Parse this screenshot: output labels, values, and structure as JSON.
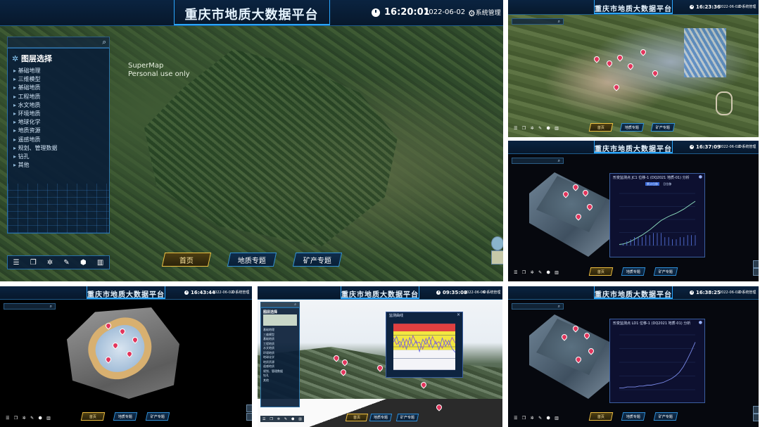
{
  "app_title": "重庆市地质大数据平台",
  "system_menu": "系统管理",
  "nav_buttons": {
    "home": "首页",
    "geology": "地质专题",
    "mining": "矿产专题"
  },
  "main_panel": {
    "time": "16:20:01",
    "date": "2022-06-02",
    "watermark_line1": "SuperMap",
    "watermark_line2": "Personal use only",
    "layer_panel_title": "图层选择",
    "layer_items": [
      "基础地理",
      "三维模型",
      "基础地质",
      "工程地质",
      "水文地质",
      "环境地质",
      "地球化学",
      "地质资源",
      "遥感地质",
      "规划、管理数据",
      "钻孔",
      "其他"
    ]
  },
  "panel_tr": {
    "time": "16:23:36",
    "date": "2022-06-02"
  },
  "panel_mr": {
    "time": "16:37:09",
    "date": "2022-06-02",
    "chart_title": "形变监测点 JC1 位移-1 (DQ2021 地质-01) 分析",
    "legend": [
      "累计位移",
      "日位移"
    ],
    "chart_data": {
      "type": "line",
      "x": [
        0,
        1,
        2,
        3,
        4,
        5,
        6,
        7,
        8,
        9,
        10,
        11,
        12,
        13,
        14,
        15,
        16,
        17,
        18,
        19,
        20
      ],
      "series": [
        {
          "values": [
            2,
            3,
            5,
            8,
            12,
            16,
            20,
            25,
            30,
            36,
            42,
            48,
            52,
            56,
            59,
            62,
            66,
            70,
            75,
            80,
            85
          ]
        }
      ],
      "ylim": [
        0,
        100
      ]
    }
  },
  "panel_bl": {
    "time": "16:43:44",
    "date": "2022-06-02"
  },
  "panel_bm": {
    "time": "09:35:08",
    "date": "2022-06-06",
    "tree_title": "图层选择",
    "tree_items": [
      "基础地理",
      "三维模型",
      "基础地质",
      "工程地质",
      "水文地质",
      "环境地质",
      "地球化学",
      "地质资源",
      "遥感地质",
      "规划、管理数据",
      "钻孔",
      "其他"
    ],
    "chart_title": "监测曲线",
    "chart_data": {
      "type": "line",
      "x": [
        0,
        1,
        2,
        3,
        4,
        5,
        6,
        7,
        8,
        9,
        10,
        11,
        12,
        13,
        14,
        15,
        16,
        17,
        18,
        19
      ],
      "series": [
        {
          "values": [
            70,
            55,
            62,
            48,
            66,
            52,
            74,
            58,
            60,
            45,
            68,
            50,
            72,
            56,
            61,
            47,
            65,
            53,
            70,
            58
          ]
        },
        {
          "values": [
            60,
            72,
            50,
            68,
            45,
            70,
            52,
            63,
            40,
            66,
            55,
            71,
            48,
            62,
            44,
            69,
            51,
            64,
            46,
            38
          ]
        }
      ],
      "ylim": [
        0,
        100
      ]
    }
  },
  "panel_br": {
    "time": "16:38:25",
    "date": "2022-06-02",
    "chart_title": "形变监测点 LD1 位移-1 (DQ2021 地质-01) 分析",
    "chart_data": {
      "type": "line",
      "x": [
        0,
        1,
        2,
        3,
        4,
        5,
        6,
        7,
        8,
        9,
        10,
        11,
        12,
        13,
        14,
        15,
        16,
        17,
        18,
        19
      ],
      "series": [
        {
          "values": [
            2,
            2,
            3,
            3,
            3,
            4,
            4,
            5,
            5,
            6,
            7,
            8,
            10,
            12,
            15,
            19,
            25,
            33,
            42,
            52
          ]
        }
      ],
      "ylim": [
        0,
        60
      ]
    }
  },
  "colors": {
    "accent": "#2aa7ff",
    "header_bg": "#0a2340",
    "active_button": "#f0c040",
    "pin": "#e2355c"
  }
}
